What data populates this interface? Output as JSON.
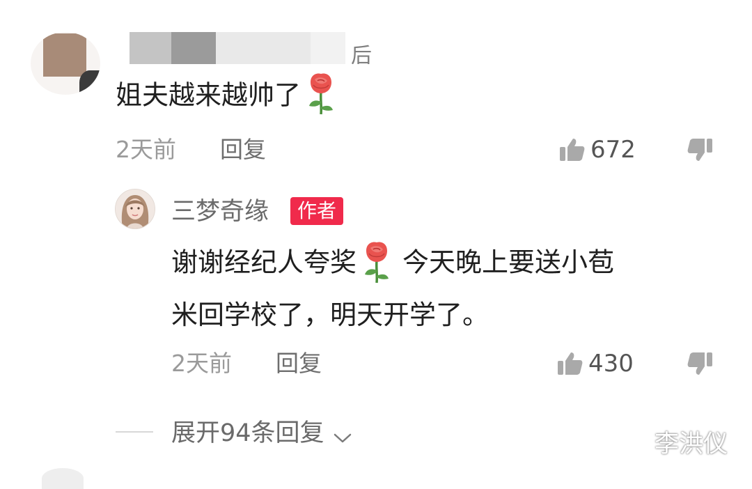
{
  "top_comment": {
    "username_visible_tail": "后叔)",
    "text": "姐夫越来越帅了",
    "emoji": "rose-emoji",
    "time": "2天前",
    "reply_label": "回复",
    "likes": "672"
  },
  "author_reply": {
    "username": "三梦奇缘",
    "author_tag": "作者",
    "line1_before_emoji": "谢谢经纪人夸奖",
    "line1_after_emoji": "今天晚上要送小苞",
    "line2": "米回学校了，明天开学了。",
    "time": "2天前",
    "reply_label": "回复",
    "likes": "430"
  },
  "expand": {
    "label": "展开94条回复"
  },
  "watermark": "李洪仪",
  "colors": {
    "author_tag_bg": "#f02a4b",
    "text_primary": "#1f1f1f",
    "text_secondary": "#9a9a9a",
    "icon_gray": "#a9a9a9"
  },
  "icons": [
    "thumbs-up-icon",
    "thumbs-down-icon",
    "chevron-down-icon",
    "rose-emoji"
  ]
}
